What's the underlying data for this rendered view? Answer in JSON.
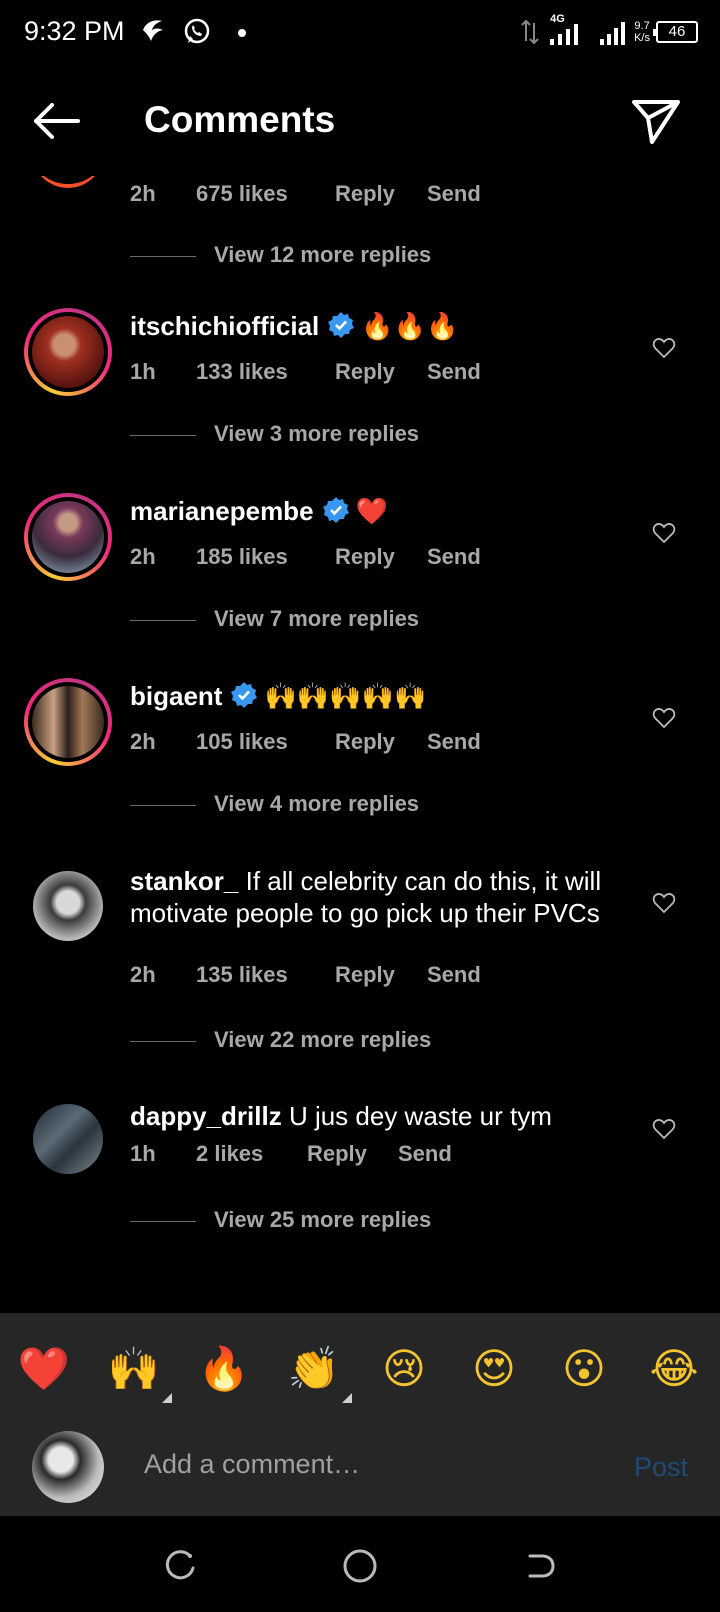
{
  "status_bar": {
    "time": "9:32 PM",
    "network_type": "4G",
    "net_speed_value": "9.7",
    "net_speed_unit": "K/s",
    "battery": "46"
  },
  "header": {
    "title": "Comments"
  },
  "comments": [
    {
      "time": "2h",
      "likes": "675 likes",
      "reply": "Reply",
      "send": "Send",
      "view_replies": "View 12 more replies"
    },
    {
      "username": "itschichiofficial",
      "verified": true,
      "text": "🔥🔥🔥",
      "time": "1h",
      "likes": "133 likes",
      "reply": "Reply",
      "send": "Send",
      "view_replies": "View 3 more replies",
      "avatar_color": "#7a1a14"
    },
    {
      "username": "marianepembe",
      "verified": true,
      "text": "❤️",
      "time": "2h",
      "likes": "185 likes",
      "reply": "Reply",
      "send": "Send",
      "view_replies": "View 7 more replies",
      "avatar_color": "#4a2a3c"
    },
    {
      "username": "bigaent",
      "verified": true,
      "text": "🙌🙌🙌🙌🙌",
      "time": "2h",
      "likes": "105 likes",
      "reply": "Reply",
      "send": "Send",
      "view_replies": "View 4 more replies",
      "avatar_color": "#6b4a2a"
    },
    {
      "username": "stankor_",
      "verified": false,
      "text": "If all celebrity can do this, it will motivate people to go pick up their PVCs",
      "time": "2h",
      "likes": "135 likes",
      "reply": "Reply",
      "send": "Send",
      "view_replies": "View 22 more replies",
      "avatar_color": "#8c8c8c"
    },
    {
      "username": "dappy_drillz",
      "verified": false,
      "text": "U jus dey waste ur tym",
      "time": "1h",
      "likes": "2 likes",
      "reply": "Reply",
      "send": "Send",
      "view_replies": "View 25 more replies",
      "avatar_color": "#2e3a44"
    }
  ],
  "reactions": [
    {
      "emoji": "❤️",
      "name": "red-heart"
    },
    {
      "emoji": "🙌",
      "name": "raising-hands"
    },
    {
      "emoji": "🔥",
      "name": "fire"
    },
    {
      "emoji": "👏",
      "name": "clapping-hands"
    },
    {
      "emoji": "😢",
      "name": "crying-face"
    },
    {
      "emoji": "😍",
      "name": "heart-eyes"
    },
    {
      "emoji": "😮",
      "name": "open-mouth-face"
    },
    {
      "emoji": "😂",
      "name": "tears-of-joy"
    }
  ],
  "composer": {
    "placeholder": "Add a comment…",
    "post_label": "Post"
  },
  "colors": {
    "background": "#000000",
    "meta_text": "#a8a8a8",
    "verified_blue": "#3897f0",
    "post_disabled": "#1f4b78",
    "composer_bg": "#262626"
  }
}
